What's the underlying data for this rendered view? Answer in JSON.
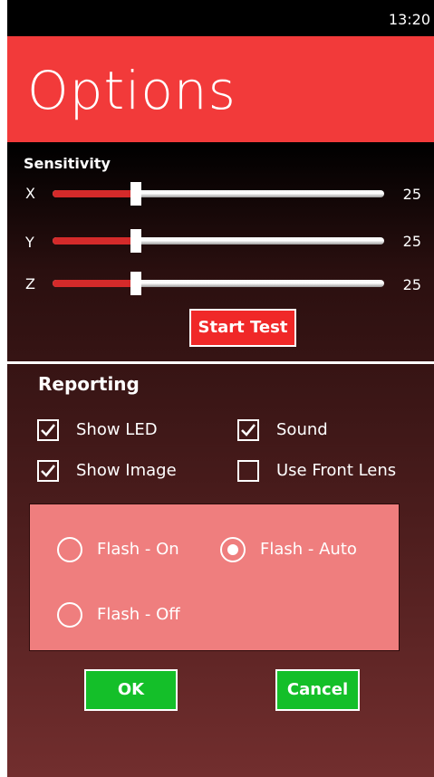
{
  "status_bar": {
    "time": "13:20"
  },
  "header": {
    "title": "Options"
  },
  "sensitivity": {
    "label": "Sensitivity",
    "sliders": [
      {
        "axis": "X",
        "value": "25",
        "fraction": 0.25
      },
      {
        "axis": "Y",
        "value": "25",
        "fraction": 0.25
      },
      {
        "axis": "Z",
        "value": "25",
        "fraction": 0.25
      }
    ],
    "start_test_label": "Start Test"
  },
  "reporting": {
    "label": "Reporting",
    "checkboxes": [
      {
        "label": "Show LED",
        "checked": true
      },
      {
        "label": "Sound",
        "checked": true
      },
      {
        "label": "Show Image",
        "checked": true
      },
      {
        "label": "Use Front Lens",
        "checked": false
      }
    ]
  },
  "flash": {
    "options": [
      {
        "label": "Flash - On",
        "selected": false
      },
      {
        "label": "Flash - Auto",
        "selected": true
      },
      {
        "label": "Flash - Off",
        "selected": false
      }
    ]
  },
  "actions": {
    "ok_label": "OK",
    "cancel_label": "Cancel"
  },
  "colors": {
    "header": "#f23a3a",
    "slider_fill": "#d42a2a",
    "start_button": "#f02828",
    "flash_panel": "#ef7e7e",
    "action_button": "#14bf29"
  }
}
